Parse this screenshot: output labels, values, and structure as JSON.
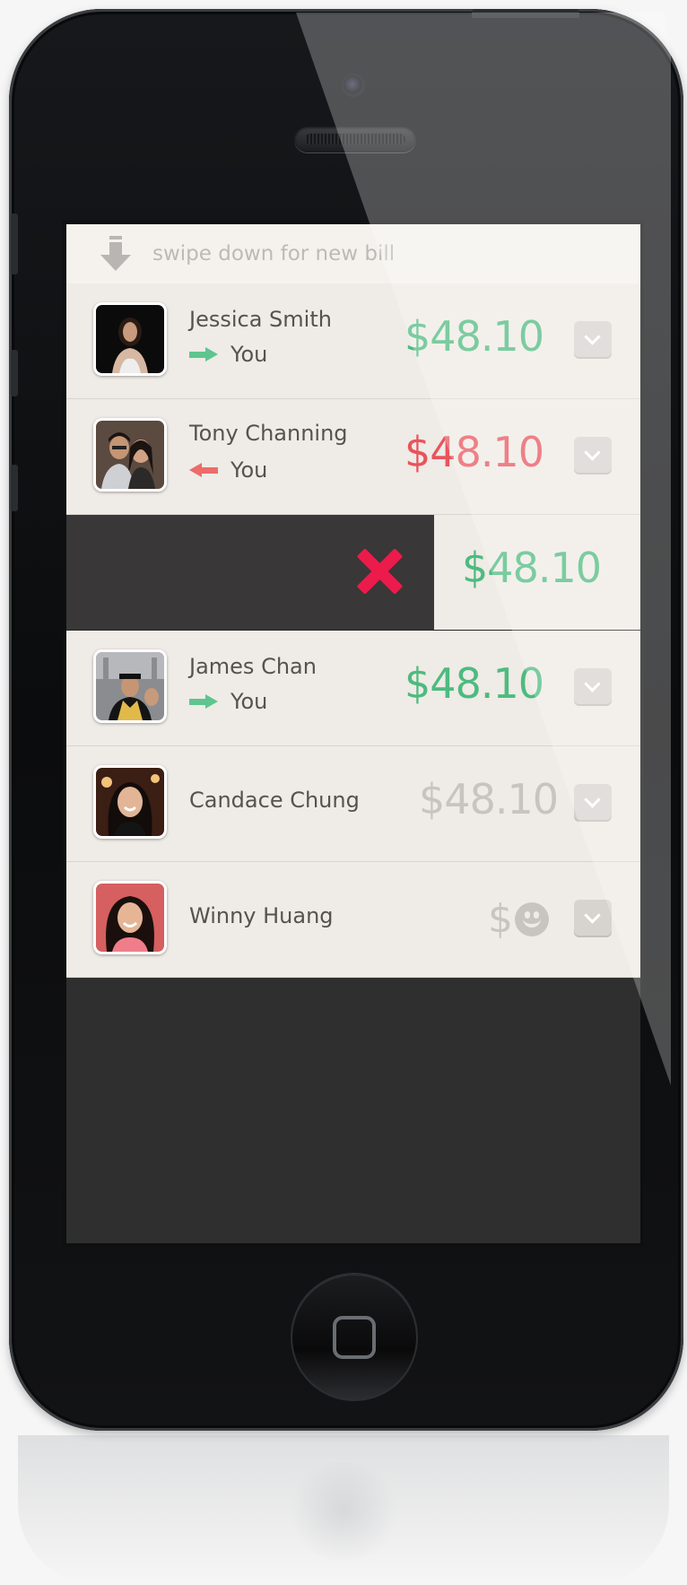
{
  "header": {
    "pull_hint": "swipe down for new bill",
    "pull_icon": "arrow-down-icon"
  },
  "rows": [
    {
      "name": "Jessica Smith",
      "direction": "to-you",
      "direction_label": "You",
      "amount": "$48.10",
      "amount_color": "#4dbb7f",
      "avatar": "avatar-jessica"
    },
    {
      "name": "Tony Channing",
      "direction": "from-you",
      "direction_label": "You",
      "amount": "$48.10",
      "amount_color": "#e9545c",
      "avatar": "avatar-tony"
    },
    {
      "swiped": true,
      "amount": "$48.10",
      "amount_color": "#4dbb7f",
      "action_icon": "delete-x-icon",
      "action_color": "#ec1b4b"
    },
    {
      "name": "James Chan",
      "direction": "to-you",
      "direction_label": "You",
      "amount": "$48.10",
      "amount_color": "#4dbb7f",
      "avatar": "avatar-james"
    },
    {
      "name": "Candace Chung",
      "amount": "$48.10",
      "amount_color": "#c8c5c1",
      "avatar": "avatar-candace"
    },
    {
      "name": "Winny Huang",
      "amount": "$",
      "settled_icon": "smiley-icon",
      "amount_color": "#c8c5c1",
      "avatar": "avatar-winny"
    }
  ],
  "colors": {
    "positive": "#4dbb7f",
    "negative": "#e9545c",
    "muted": "#c8c5c1",
    "row_bg": "#efebe6",
    "screen_bg": "#2f2f2f",
    "delete": "#ec1b4b"
  }
}
